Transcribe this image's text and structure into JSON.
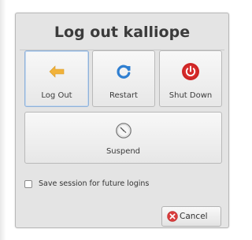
{
  "dialog": {
    "title": "Log out kalliope",
    "buttons": {
      "logout": "Log Out",
      "restart": "Restart",
      "shutdown": "Shut Down",
      "suspend": "Suspend"
    },
    "save_session_label": "Save session for future logins",
    "save_session_checked": false,
    "cancel_label": "Cancel"
  },
  "icons": {
    "logout": "arrow-left-icon",
    "restart": "refresh-icon",
    "shutdown": "power-icon",
    "suspend": "clock-icon",
    "cancel": "cancel-icon"
  },
  "colors": {
    "logout_arrow": "#f1b23a",
    "restart": "#2f7fd1",
    "shutdown": "#d62a2a",
    "cancel": "#d83b3b",
    "focus_border": "#8fb1d8"
  }
}
